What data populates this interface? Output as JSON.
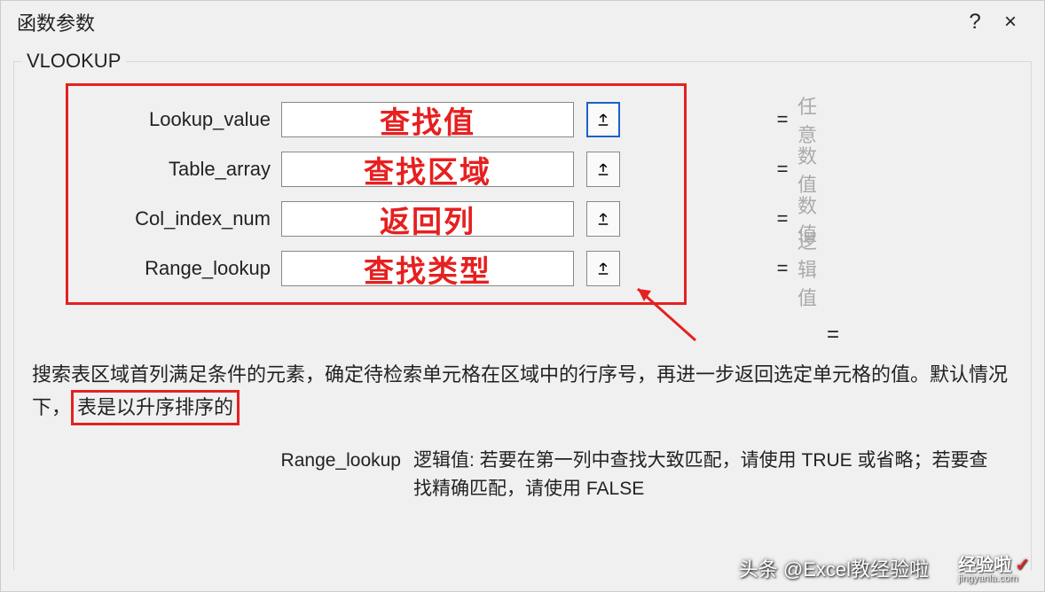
{
  "dialog": {
    "title": "函数参数",
    "help": "?",
    "close": "×"
  },
  "fn": {
    "name": "VLOOKUP",
    "result_eq": "="
  },
  "params": [
    {
      "label": "Lookup_value",
      "overlay": "查找值",
      "type": "任意",
      "highlight": true
    },
    {
      "label": "Table_array",
      "overlay": "查找区域",
      "type": "数值",
      "highlight": false
    },
    {
      "label": "Col_index_num",
      "overlay": "返回列",
      "type": "数值",
      "highlight": false
    },
    {
      "label": "Range_lookup",
      "overlay": "查找类型",
      "type": "逻辑值",
      "highlight": false
    }
  ],
  "eq": "=",
  "desc": {
    "line1a": "搜索表区域首列满足条件的元素，确定待检索单元格在区域中的行序号，再进一步返回选定单元格的值。默认情况下，",
    "highlight": "表是以升序排序的"
  },
  "param_desc": {
    "name": "Range_lookup",
    "text": "逻辑值: 若要在第一列中查找大致匹配，请使用 TRUE 或省略；若要查找精确匹配，请使用 FALSE"
  },
  "watermark1": "头条 @Excel教经验啦",
  "watermark2": {
    "main": "经验啦",
    "sub": "jingyanla.com",
    "check": "✓"
  }
}
